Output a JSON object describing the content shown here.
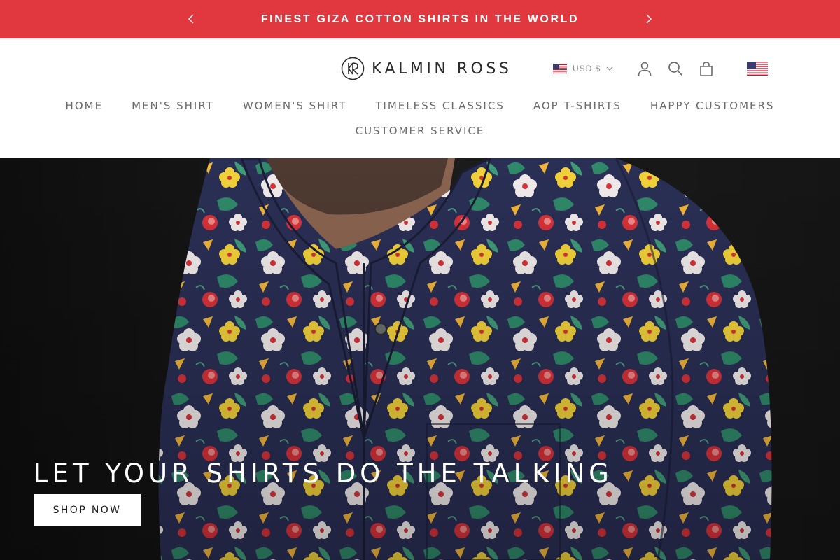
{
  "announcement": {
    "message": "FINEST GIZA COTTON SHIRTS IN THE WORLD",
    "prev_icon": "chevron-left-icon",
    "next_icon": "chevron-right-icon",
    "background_color": "#e0383e"
  },
  "header": {
    "logo_text": "KALMIN ROSS",
    "logo_monogram": "KR",
    "currency": {
      "label": "USD $",
      "flag_icon": "us-flag-icon",
      "dropdown_icon": "chevron-down-icon"
    },
    "icons": [
      "account-icon",
      "search-icon",
      "shopping-bag-icon",
      "us-flag-icon"
    ]
  },
  "nav": {
    "row1": [
      "HOME",
      "MEN'S SHIRT",
      "WOMEN'S SHIRT",
      "TIMELESS CLASSICS",
      "AOP T-SHIRTS",
      "HAPPY CUSTOMERS"
    ],
    "row2": [
      "CUSTOMER SERVICE"
    ]
  },
  "hero": {
    "title": "LET YOUR SHIRTS DO THE TALKING",
    "button_label": "SHOP NOW"
  }
}
